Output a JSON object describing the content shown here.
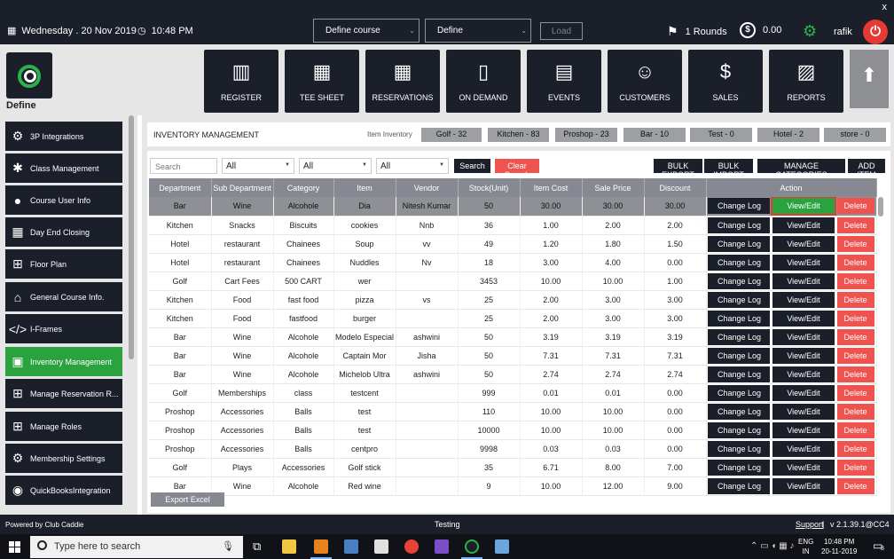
{
  "topbar": {
    "date": "Wednesday . 20 Nov 2019",
    "time": "10:48 PM",
    "course_select": "Define  course",
    "define_select": "Define",
    "load_label": "Load",
    "rounds": "1 Rounds",
    "money": "0.00",
    "user": "rafik",
    "close_glyph": "x"
  },
  "brand": {
    "name": "Define"
  },
  "nav_tiles": [
    {
      "label": "REGISTER",
      "icon": "barcode-scanner-icon"
    },
    {
      "label": "TEE SHEET",
      "icon": "calendar-icon"
    },
    {
      "label": "RESERVATIONS",
      "icon": "calendar-icon"
    },
    {
      "label": "ON DEMAND",
      "icon": "mobile-icon"
    },
    {
      "label": "EVENTS",
      "icon": "calendar-grid-icon"
    },
    {
      "label": "CUSTOMERS",
      "icon": "people-icon"
    },
    {
      "label": "SALES",
      "icon": "money-icon"
    },
    {
      "label": "REPORTS",
      "icon": "report-icon"
    }
  ],
  "sidebar": {
    "items": [
      {
        "label": "3P Integrations",
        "icon": "integration-icon"
      },
      {
        "label": "Class Management",
        "icon": "class-icon"
      },
      {
        "label": "Course User Info",
        "icon": "user-icon"
      },
      {
        "label": "Day End Closing",
        "icon": "calendar-icon"
      },
      {
        "label": "Floor Plan",
        "icon": "floor-plan-icon"
      },
      {
        "label": "General Course Info.",
        "icon": "home-icon"
      },
      {
        "label": "I-Frames",
        "icon": "code-icon"
      },
      {
        "label": "Inventory Management",
        "icon": "inventory-icon",
        "active": true
      },
      {
        "label": "Manage Reservation R...",
        "icon": "reservation-icon"
      },
      {
        "label": "Manage Roles",
        "icon": "roles-icon"
      },
      {
        "label": "Membership Settings",
        "icon": "gear-icon"
      },
      {
        "label": "QuickBooksIntegration",
        "icon": "quickbooks-icon"
      }
    ]
  },
  "inventory": {
    "title": "INVENTORY MANAGEMENT",
    "item_inventory_label": "Item Inventory",
    "categories": [
      "Golf - 32",
      "Kitchen - 83",
      "Proshop - 23",
      "Bar - 10",
      "Test - 0",
      "Hotel - 2",
      "store - 0"
    ],
    "search_placeholder": "Search",
    "filters": [
      "All",
      "All",
      "All"
    ],
    "search_btn": "Search",
    "clear_btn": "Clear Search",
    "bulk_export": "BULK EXPORT",
    "bulk_import": "BULK IMPORT",
    "manage_categories": "MANAGE CATEGORIES",
    "add_item": "ADD ITEM",
    "columns": [
      "Department",
      "Sub Department",
      "Category",
      "Item",
      "Vendor",
      "Stock(Unit)",
      "Item Cost",
      "Sale Price",
      "Discount",
      "Action"
    ],
    "action_labels": {
      "log": "Change Log",
      "view": "View/Edit",
      "delete": "Delete"
    },
    "rows": [
      [
        "Bar",
        "Wine",
        "Alcohole",
        "Dia",
        "Nitesh Kumar",
        "50",
        "30.00",
        "30.00",
        "30.00"
      ],
      [
        "Kitchen",
        "Snacks",
        "Biscuits",
        "cookies",
        "Nnb",
        "36",
        "1.00",
        "2.00",
        "2.00"
      ],
      [
        "Hotel",
        "restaurant",
        "Chainees",
        "Soup",
        "vv",
        "49",
        "1.20",
        "1.80",
        "1.50"
      ],
      [
        "Hotel",
        "restaurant",
        "Chainees",
        "Nuddles",
        "Nv",
        "18",
        "3.00",
        "4.00",
        "0.00"
      ],
      [
        "Golf",
        "Cart Fees",
        "500 CART",
        "wer",
        "",
        "3453",
        "10.00",
        "10.00",
        "1.00"
      ],
      [
        "Kitchen",
        "Food",
        "fast food",
        "pizza",
        "vs",
        "25",
        "2.00",
        "3.00",
        "3.00"
      ],
      [
        "Kitchen",
        "Food",
        "fastfood",
        "burger",
        "",
        "25",
        "2.00",
        "3.00",
        "3.00"
      ],
      [
        "Bar",
        "Wine",
        "Alcohole",
        "Modelo Especial",
        "ashwini",
        "50",
        "3.19",
        "3.19",
        "3.19"
      ],
      [
        "Bar",
        "Wine",
        "Alcohole",
        "Captain Mor",
        "Jisha",
        "50",
        "7.31",
        "7.31",
        "7.31"
      ],
      [
        "Bar",
        "Wine",
        "Alcohole",
        "Michelob Ultra",
        "ashwini",
        "50",
        "2.74",
        "2.74",
        "2.74"
      ],
      [
        "Golf",
        "Memberships",
        "class",
        "testcent",
        "",
        "999",
        "0.01",
        "0.01",
        "0.00"
      ],
      [
        "Proshop",
        "Accessories",
        "Balls",
        "test",
        "",
        "110",
        "10.00",
        "10.00",
        "0.00"
      ],
      [
        "Proshop",
        "Accessories",
        "Balls",
        "test",
        "",
        "10000",
        "10.00",
        "10.00",
        "0.00"
      ],
      [
        "Proshop",
        "Accessories",
        "Balls",
        "centpro",
        "",
        "9998",
        "0.03",
        "0.03",
        "0.00"
      ],
      [
        "Golf",
        "Plays",
        "Accessories",
        "Golf stick",
        "",
        "35",
        "6.71",
        "8.00",
        "7.00"
      ],
      [
        "Bar",
        "Wine",
        "Alcohole",
        "Red wine",
        "",
        "9",
        "10.00",
        "12.00",
        "9.00"
      ]
    ],
    "export_btn": "Export Excel"
  },
  "footer": {
    "powered": "Powered by Club Caddie",
    "mid": "Testing",
    "support": "Support",
    "sep": "|",
    "version": "v 2.1.39.1@CC4"
  },
  "taskbar": {
    "search_placeholder": "Type here to search",
    "lang1": "ENG",
    "lang2": "IN",
    "time": "10:48 PM",
    "date": "20-11-2019",
    "notif_count": "8"
  },
  "colors": {
    "accent_green": "#2aa33f",
    "dark": "#1b1f2a",
    "danger": "#ef5350"
  }
}
